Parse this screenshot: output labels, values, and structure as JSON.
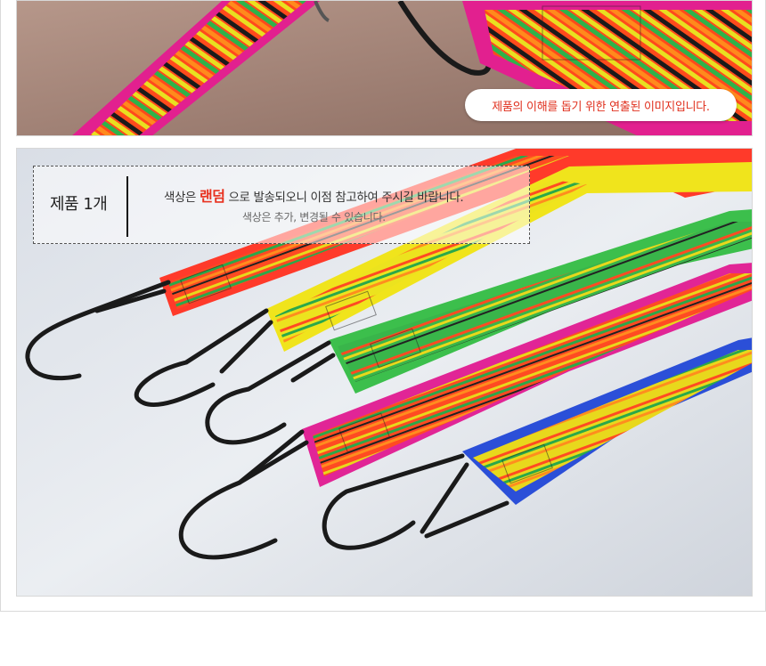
{
  "top_image": {
    "caption": "제품의 이해를 돕기 위한 연출된 이미지입니다."
  },
  "main_image": {
    "notice_label": "제품 1개",
    "notice_line1_prefix": "색상은",
    "notice_line1_highlight": "랜덤",
    "notice_line1_suffix": "으로 발송되오니 이점 참고하여 주시길 바랍니다.",
    "notice_line2": "색상은 추가, 변경될 수 있습니다."
  },
  "colors": {
    "caption_text": "#e0301e",
    "highlight": "#e8311f",
    "hook": "#1a1a1a"
  },
  "icons": [
    "bungee-cord-illustration"
  ]
}
